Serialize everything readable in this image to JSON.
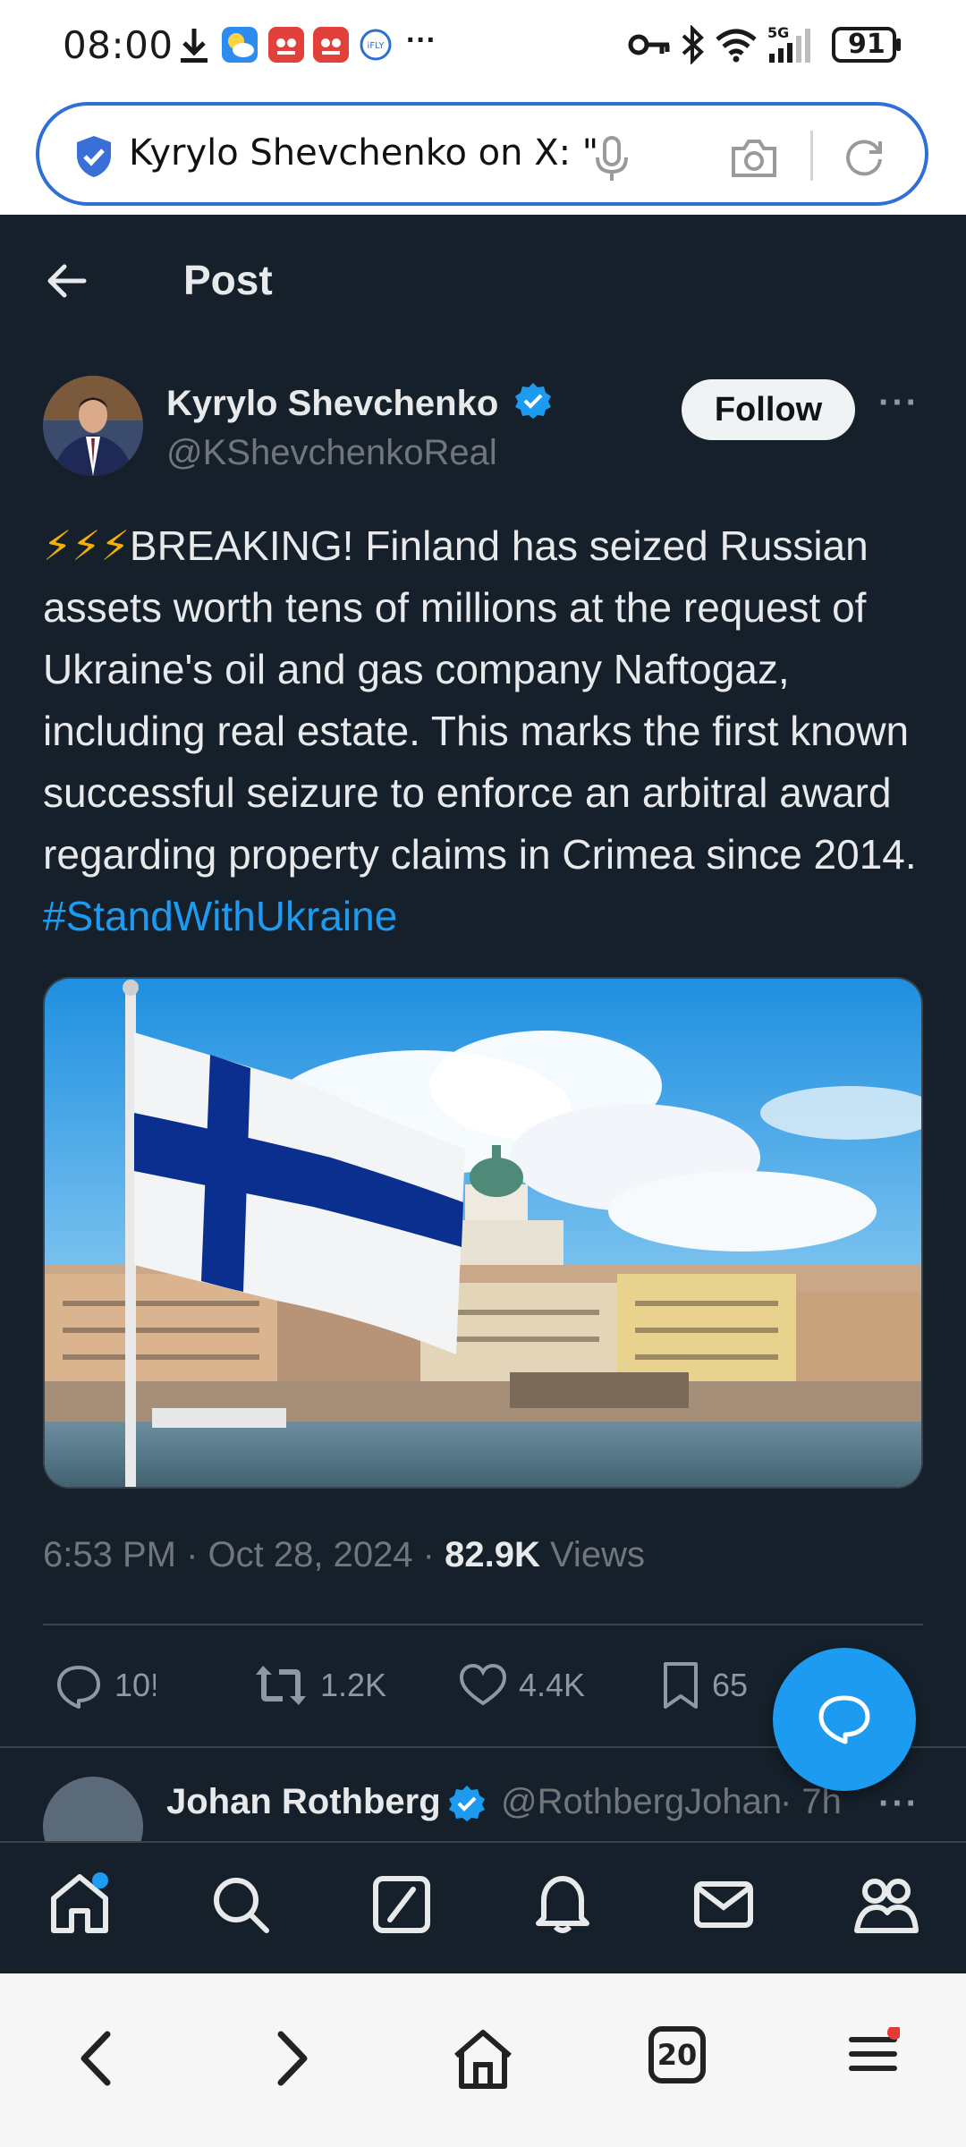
{
  "status_bar": {
    "time": "08:00",
    "network": "5G",
    "battery": "91"
  },
  "url_bar": {
    "text": "Kyrylo Shevchenko on X: \""
  },
  "header": {
    "title": "Post"
  },
  "post": {
    "author_name": "Kyrylo Shevchenko",
    "author_handle": "@KShevchenkoReal",
    "follow_label": "Follow",
    "emoji": "⚡⚡⚡",
    "text": "BREAKING! Finland has seized Russian assets worth tens of millions at the request of Ukraine's oil and gas company Naftogaz, including real estate. This marks the first known successful seizure to enforce an arbitral award regarding property claims in Crimea since 2014. ",
    "hashtag": "#StandWithUkraine",
    "timestamp": "6:53 PM · Oct 28, 2024 · ",
    "views_count": "82.9K",
    "views_label": " Views"
  },
  "actions": {
    "replies": "10!",
    "reposts": "1.2K",
    "likes": "4.4K",
    "bookmarks": "65"
  },
  "reply": {
    "name": "Johan Rothberg",
    "handle": "@RothbergJohan",
    "time": "· 7h"
  },
  "browser_bar": {
    "tabs_count": "20"
  },
  "colors": {
    "background": "#15202b",
    "accent": "#1d9bf0",
    "text_primary": "#e7e9ea",
    "text_secondary": "#71767b",
    "url_border": "#2f6fd6"
  },
  "icons": [
    "download-icon",
    "weather-icon",
    "app-icon",
    "app-icon",
    "ifly-icon",
    "key-icon",
    "bluetooth-icon",
    "wifi-icon",
    "signal-icon",
    "battery-icon",
    "verified-shield-icon",
    "mic-icon",
    "camera-icon",
    "refresh-icon",
    "back-arrow-icon",
    "verified-badge-icon",
    "reply-icon",
    "repost-icon",
    "like-icon",
    "bookmark-icon",
    "compose-icon",
    "home-icon",
    "search-icon",
    "grok-icon",
    "notifications-icon",
    "messages-icon",
    "communities-icon",
    "browser-back-icon",
    "browser-forward-icon",
    "browser-home-icon",
    "tabs-icon",
    "menu-icon"
  ]
}
